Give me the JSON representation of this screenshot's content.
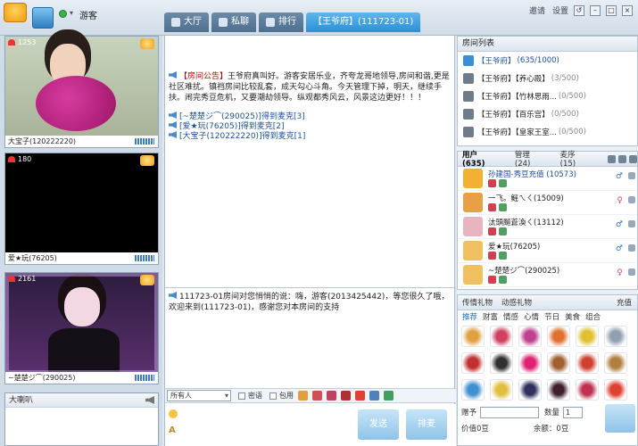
{
  "header": {
    "user_name": "游客",
    "tabs": [
      {
        "label": "大厅"
      },
      {
        "label": "私聊"
      },
      {
        "label": "排行"
      },
      {
        "label": "【王爷府】(111723-01)"
      }
    ],
    "right_links": [
      "邀请",
      "设置"
    ]
  },
  "videos": [
    {
      "count": "1253",
      "label": "大宝子(120222220)"
    },
    {
      "count": "180",
      "label": "爱★玩(76205)"
    },
    {
      "count": "2161",
      "label": "~楚楚ジ⌒(290025)"
    }
  ],
  "speaker": {
    "title": "大喇叭"
  },
  "chat": {
    "announcement_tag": "【房间公告】",
    "announcement_body": "王爷府真叫好。游客安居乐业，齐夸龙哥地领导,房间和谐,更是社区难扰。镇裆房间比较乱套，成天勾心斗角。今天管理下掉，明天，继续手扶。闹完秀豆危机，又要潮劫领导。纵观都秀风云，风景这边更好！！！",
    "system_lines": [
      "[~楚楚ジ⌒(290025)]得到麦克[3]",
      "[爱★玩(76205)]得到麦克[2]",
      "[大宝子(120222220)]得到麦克[1]"
    ],
    "private_message": "111723-01房间对您悄悄的说：嗨，游客(2013425442)，等您很久了哦，欢迎来到(111723-01)，感谢您对本房间的支持",
    "target_select": "所有人",
    "secret_label": "密语",
    "wrap_label": "包用",
    "send_label": "发送",
    "mic_label": "排麦"
  },
  "rooms": {
    "title": "房间列表",
    "items": [
      {
        "name": "【王爷府】",
        "count": "(635/1000)",
        "main": true
      },
      {
        "name": "【王爷府】【养心殿】",
        "count": "(3/500)",
        "main": false
      },
      {
        "name": "【王爷府】【竹林思雨...",
        "count": "(0/500)",
        "main": false
      },
      {
        "name": "【王爷府】【百乐宫】",
        "count": "(0/500)",
        "main": false
      },
      {
        "name": "【王爷府】【皇家王室...",
        "count": "(0/500)",
        "main": false
      }
    ]
  },
  "users": {
    "tabs": [
      "用户 (635)",
      "管理 (24)",
      "麦序 (15)"
    ],
    "items": [
      {
        "name": "孙建国-秀豆充值 (10573)",
        "blue": true,
        "sex": "♂",
        "av": "#f2b133"
      },
      {
        "name": "一飞。鳐ㄟㄑ(15009)",
        "blue": false,
        "sex": "♀",
        "av": "#e8a048"
      },
      {
        "name": "汰頭飈蒼渙ㄑ(13112)",
        "blue": false,
        "sex": "♂",
        "av": "#e8b4c0"
      },
      {
        "name": "爱★玩(76205)",
        "blue": false,
        "sex": "♂",
        "av": "#f0c060"
      },
      {
        "name": "~楚楚ジ⌒(290025)",
        "blue": false,
        "sex": "♀",
        "av": "#f0c060"
      }
    ]
  },
  "gifts": {
    "tabs": [
      "传情礼物",
      "动感礼物"
    ],
    "right_tab": "充值",
    "categories": [
      "推荐",
      "财富",
      "情感",
      "心情",
      "节日",
      "美食",
      "组合"
    ],
    "recipient_label": "赠予",
    "quantity_label": "数量",
    "quantity_value": "1",
    "price_label": "价值0豆",
    "balance_label": "余额：0豆",
    "colors": [
      "#e0a040",
      "#d04060",
      "#c04090",
      "#e07030",
      "#e0c030",
      "#90a0b0",
      "#c03030",
      "#303030",
      "#e02070",
      "#a06030",
      "#d04030",
      "#b08040",
      "#4090d0",
      "#e0c040",
      "#303060",
      "#402030",
      "#c03050",
      "#e04030"
    ]
  }
}
